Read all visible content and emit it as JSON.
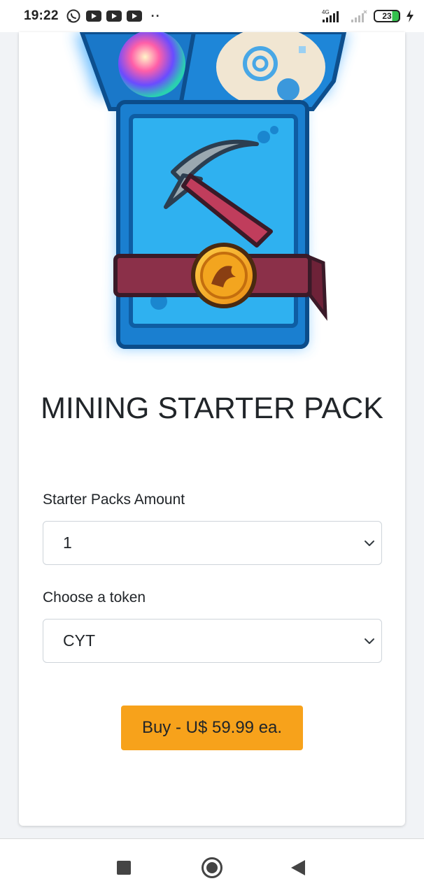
{
  "status_bar": {
    "time": "19:22",
    "network": "4G",
    "battery": "23"
  },
  "product": {
    "title": "MINING STARTER PACK"
  },
  "amount_field": {
    "label": "Starter Packs Amount",
    "value": "1"
  },
  "token_field": {
    "label": "Choose a token",
    "value": "CYT"
  },
  "buy_button": {
    "label": "Buy - U$ 59.99 ea."
  },
  "colors": {
    "accent": "#f7a21b",
    "pack_blue": "#29a8ec"
  },
  "icons": {
    "status": [
      "whatsapp-icon",
      "youtube-icon",
      "youtube-icon",
      "youtube-icon",
      "signal-icon",
      "battery-icon",
      "charging-icon"
    ],
    "nav": [
      "recents-icon",
      "home-icon",
      "back-icon"
    ]
  }
}
